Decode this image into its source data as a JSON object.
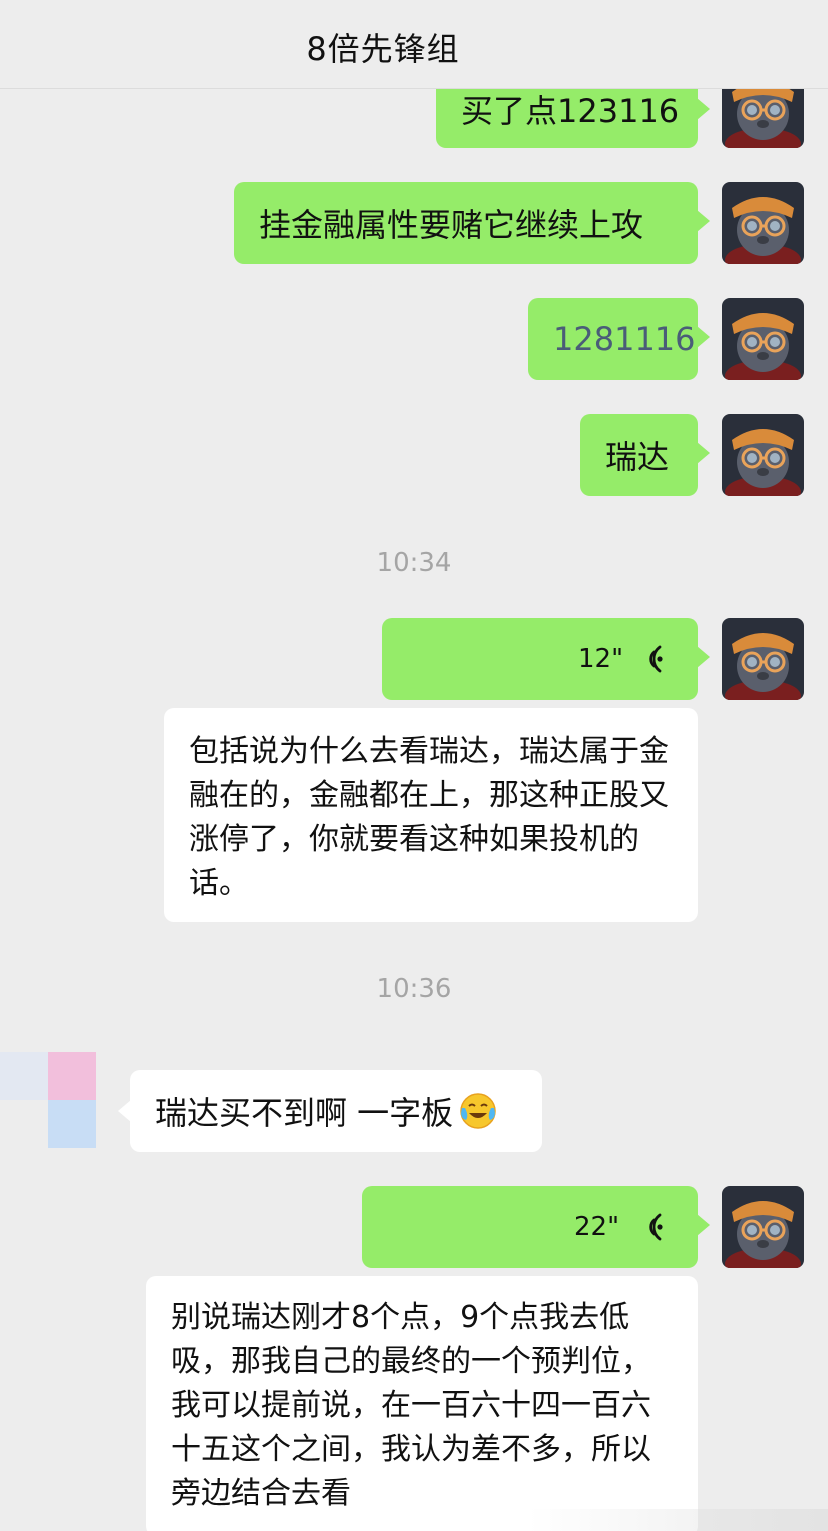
{
  "header": {
    "title": "8倍先锋组"
  },
  "messages": {
    "m1": "买了点123116",
    "m2": "挂金融属性要赌它继续上攻",
    "m3": "1281116",
    "m4": "瑞达",
    "t1": "10:34",
    "voice1": "12\"",
    "transcript1": "包括说为什么去看瑞达，瑞达属于金融在的，金融都在上，那这种正股又涨停了，你就要看这种如果投机的话。",
    "t2": "10:36",
    "m5": "瑞达买不到啊 一字板",
    "voice2": "22\"",
    "transcript2": "别说瑞达刚才8个点，9个点我去低吸，那我自己的最终的一个预判位，我可以提前说，在一百六十四一百六十五这个之间，我认为差不多，所以旁边结合去看"
  },
  "colors": {
    "background": "#ededed",
    "outgoing_bubble": "#95ec69",
    "incoming_bubble": "#ffffff",
    "timestamp": "#a5a5a5"
  }
}
